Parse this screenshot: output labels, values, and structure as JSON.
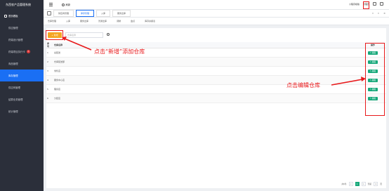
{
  "app": {
    "title": "东西农产品管理系统"
  },
  "sidebar": {
    "items": [
      {
        "label": "首页看板"
      },
      {
        "label": "供应管理"
      },
      {
        "label": "终端设计管理"
      },
      {
        "label": "终端项目执行卡",
        "badge": "1"
      },
      {
        "label": "商品管理"
      },
      {
        "label": "库存管理"
      },
      {
        "label": "供应商管理"
      },
      {
        "label": "结算业务管理"
      },
      {
        "label": "统计管理"
      }
    ]
  },
  "topbar": {
    "refresh_label": "刷新",
    "tools": [
      "小程序模版",
      "管理员",
      "1"
    ]
  },
  "tabs": {
    "items": [
      {
        "label": "供应商管理"
      },
      {
        "label": "库存管理",
        "active": true
      },
      {
        "label": "入库"
      },
      {
        "label": "服务出库"
      }
    ],
    "prev": "«",
    "next": "»",
    "close": "×"
  },
  "subtabs": [
    "仓库管理",
    "入库",
    "服务出库",
    "普通出库",
    "调拨",
    "盘点",
    "库存余额表"
  ],
  "toolbar": {
    "add_label": "+ 新增",
    "search_placeholder": "仓库名称"
  },
  "table": {
    "headers": [
      "序号",
      "仓库名称",
      "操作"
    ],
    "rows": [
      {
        "no": "1",
        "name": "总配送"
      },
      {
        "no": "2",
        "name": "仓库配送部"
      },
      {
        "no": "3",
        "name": "零售店"
      },
      {
        "no": "4",
        "name": "服务中心店"
      },
      {
        "no": "5",
        "name": "理货店"
      },
      {
        "no": "6",
        "name": "分配店"
      }
    ],
    "edit_label": "✎ 编辑"
  },
  "pagination": {
    "total": "共6条",
    "prev": "<",
    "current": "1",
    "next": ">",
    "goto": "到第",
    "page_input": "1",
    "page_unit": "页"
  },
  "annotations": {
    "add": "点击“新增”添加仓库",
    "edit": "点击编辑仓库"
  },
  "colors": {
    "accent": "#1a6ff4",
    "add_button": "#f5a623",
    "edit_button": "#19a97b",
    "annotation": "#e8191b",
    "sidebar_bg": "#2b2f3a"
  }
}
